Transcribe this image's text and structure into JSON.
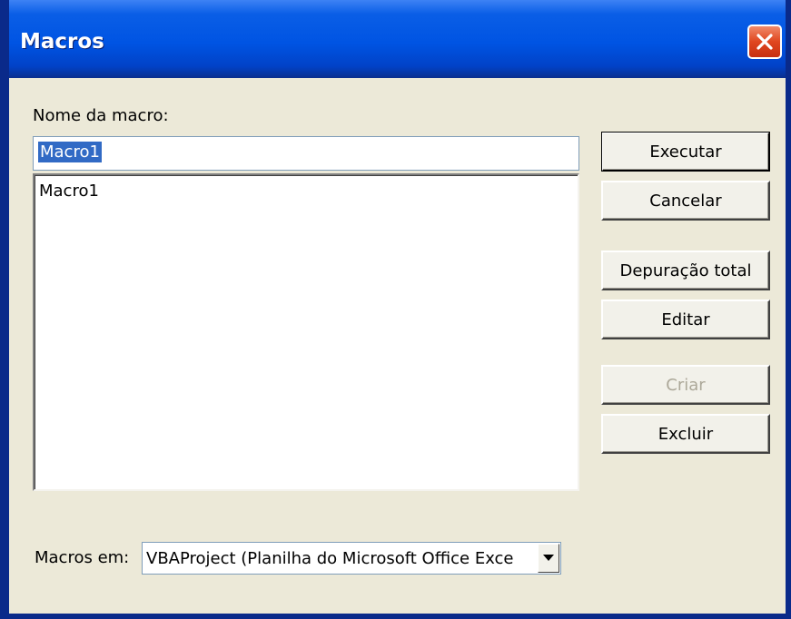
{
  "window": {
    "title": "Macros"
  },
  "name_label": "Nome da macro:",
  "name_input": {
    "value": "Macro1"
  },
  "macro_list": {
    "items": [
      "Macro1"
    ]
  },
  "buttons": {
    "run": "Executar",
    "cancel": "Cancelar",
    "step_into": "Depuração total",
    "edit": "Editar",
    "create": "Criar",
    "delete": "Excluir"
  },
  "macros_in": {
    "label": "Macros em:",
    "value": "VBAProject (Planilha do Microsoft Office Exce"
  },
  "icons": {
    "close": "close-icon",
    "dropdown": "dropdown-arrow-icon"
  },
  "colors": {
    "title_bar": "#0054e3",
    "close_button": "#e0461f",
    "selection": "#316ac5",
    "disabled_text": "#aca899"
  }
}
